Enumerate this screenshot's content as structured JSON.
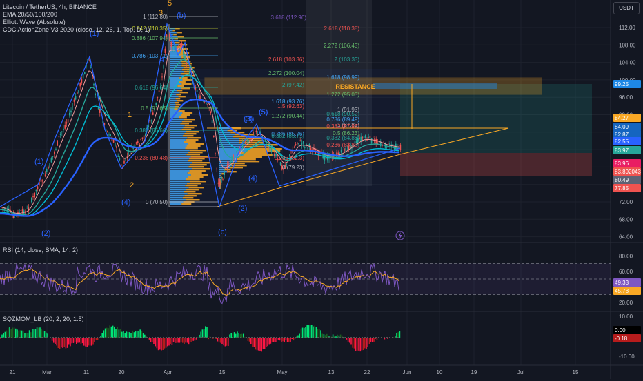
{
  "legend": {
    "symbol": "Litecoin / TetherUS, 4h, BINANCE",
    "ema": "EMA 20/50/100/200",
    "elliott": "Elliott Wave (Absolute)",
    "cdc": "CDC ActionZone V3 2020 (close, 12, 26, 1, Top, D, 1)"
  },
  "currency_button": "USDT",
  "price_axis": [
    "112.00",
    "108.00",
    "104.00",
    "100.00",
    "96.00",
    "92.00",
    "88.00",
    "84.00",
    "80.00",
    "76.00",
    "72.00",
    "68.00",
    "64.00"
  ],
  "price_tags": [
    {
      "label": "99.25",
      "color": "#1e88e5"
    },
    {
      "label": "84.27",
      "color": "#f9a825"
    },
    {
      "label": "84.09",
      "color": "#1565c0"
    },
    {
      "label": "82.87",
      "color": "#1565c0"
    },
    {
      "label": "82.55",
      "color": "#2962ff"
    },
    {
      "label": "83.97",
      "color": "#26a69a"
    },
    {
      "label": "83.96",
      "color": "#e91e63"
    },
    {
      "label": "83.892043",
      "color": "#ef5350"
    },
    {
      "label": "80.49",
      "color": "#5d6274"
    },
    {
      "label": "77.85",
      "color": "#ef5350"
    }
  ],
  "time_axis": [
    "21",
    "Mar",
    "11",
    "20",
    "Apr",
    "15",
    "May",
    "13",
    "22",
    "Jun",
    "10",
    "19",
    "Jul",
    "15"
  ],
  "resistance_label": "RESISTANCE",
  "fib_left": [
    {
      "label": "1 (112.80)",
      "color": "#b2b5be"
    },
    {
      "label": "0.942 (110.35)",
      "color": "#c0ca33"
    },
    {
      "label": "0.886 (107.94)",
      "color": "#66bb6a"
    },
    {
      "label": "0.786 (103.71)",
      "color": "#42a5f5"
    },
    {
      "label": "0.618 (96.64)",
      "color": "#26a69a"
    },
    {
      "label": "0.5 (91.65)",
      "color": "#66bb6a"
    },
    {
      "label": "0.382 (86.66)",
      "color": "#26a69a"
    },
    {
      "label": "0.236 (80.48)",
      "color": "#ef5350"
    },
    {
      "label": "0 (70.50)",
      "color": "#b2b5be"
    }
  ],
  "fib_right": [
    {
      "label": "3.618 (112.96)",
      "color": "#7e57c2"
    },
    {
      "label": "2.618 (110.38)",
      "color": "#ef5350"
    },
    {
      "label": "2.272 (106.43)",
      "color": "#66bb6a"
    },
    {
      "label": "2 (103.33)",
      "color": "#26a69a"
    },
    {
      "label": "2.618 (103.36)",
      "color": "#ef5350"
    },
    {
      "label": "2.272 (100.04)",
      "color": "#66bb6a"
    },
    {
      "label": "1.618 (98.99)",
      "color": "#42a5f5"
    },
    {
      "label": "2 (97.42)",
      "color": "#26a69a"
    },
    {
      "label": "1.272 (95.03)",
      "color": "#66bb6a"
    },
    {
      "label": "1.618 (93.76)",
      "color": "#42a5f5"
    },
    {
      "label": "1.5 (92.63)",
      "color": "#ef5350"
    },
    {
      "label": "1 (91.93)",
      "color": "#b2b5be"
    },
    {
      "label": "1.272 (90.44)",
      "color": "#66bb6a"
    },
    {
      "label": "0.618 (90.52)",
      "color": "#26a69a"
    },
    {
      "label": "0.786 (89.49)",
      "color": "#42a5f5"
    },
    {
      "label": "1 (87.83)",
      "color": "#b2b5be"
    },
    {
      "label": "0.382 (87.96)",
      "color": "#ef5350"
    },
    {
      "label": "0.5 (86.23)",
      "color": "#66bb6a"
    },
    {
      "label": "0.382 (84.88)",
      "color": "#26a69a"
    },
    {
      "label": "0.236 (83.85)",
      "color": "#ef5350"
    },
    {
      "label": "0.786 (85.76)",
      "color": "#42a5f5"
    },
    {
      "label": "0.382 (85.71)",
      "color": "#26a69a"
    },
    {
      "label": "0.236 (82.3)",
      "color": "#ef5350"
    },
    {
      "label": "0 (79.23)",
      "color": "#b2b5be"
    }
  ],
  "waves": [
    {
      "label": "(1)",
      "color": "#2962ff"
    },
    {
      "label": "(2)",
      "color": "#2962ff"
    },
    {
      "label": "(3)",
      "color": "#2962ff"
    },
    {
      "label": "(4)",
      "color": "#2962ff"
    },
    {
      "label": "(5)",
      "color": "#2962ff"
    },
    {
      "label": "1",
      "color": "#f9a825"
    },
    {
      "label": "2",
      "color": "#f9a825"
    },
    {
      "label": "3",
      "color": "#f9a825"
    },
    {
      "label": "4",
      "color": "#2962ff"
    },
    {
      "label": "5",
      "color": "#f9a825"
    },
    {
      "label": "(b)",
      "color": "#2962ff"
    },
    {
      "label": "(c)",
      "color": "#2962ff"
    },
    {
      "label": "(1)",
      "color": "#2962ff"
    },
    {
      "label": "(2)",
      "color": "#2962ff"
    },
    {
      "label": "(3)",
      "color": "#2962ff"
    },
    {
      "label": "(4)",
      "color": "#2962ff"
    },
    {
      "label": "(5)",
      "color": "#2962ff"
    }
  ],
  "rsi": {
    "label": "RSI (14, close, SMA, 14, 2)",
    "axis": [
      "80.00",
      "60.00",
      "40.00",
      "20.00"
    ],
    "tags": [
      {
        "label": "49.33",
        "color": "#7e57c2"
      },
      {
        "label": "45.78",
        "color": "#f9a825"
      }
    ]
  },
  "sqz": {
    "label": "SQZMOM_LB (20, 2, 20, 1.5)",
    "axis": [
      "10.00",
      "0.00",
      "-10.00"
    ],
    "tags": [
      {
        "label": "0.00",
        "color": "#000000"
      },
      {
        "label": "-0.18",
        "color": "#b71c1c"
      }
    ]
  },
  "colors": {
    "background": "#131722",
    "grid": "#1e222d",
    "up": "#26a69a",
    "down": "#ef5350",
    "ema20": "#26a69a",
    "ema50": "#2962ff",
    "volume_profile_up": "#42a5f5",
    "volume_profile_down": "#f9a825"
  }
}
